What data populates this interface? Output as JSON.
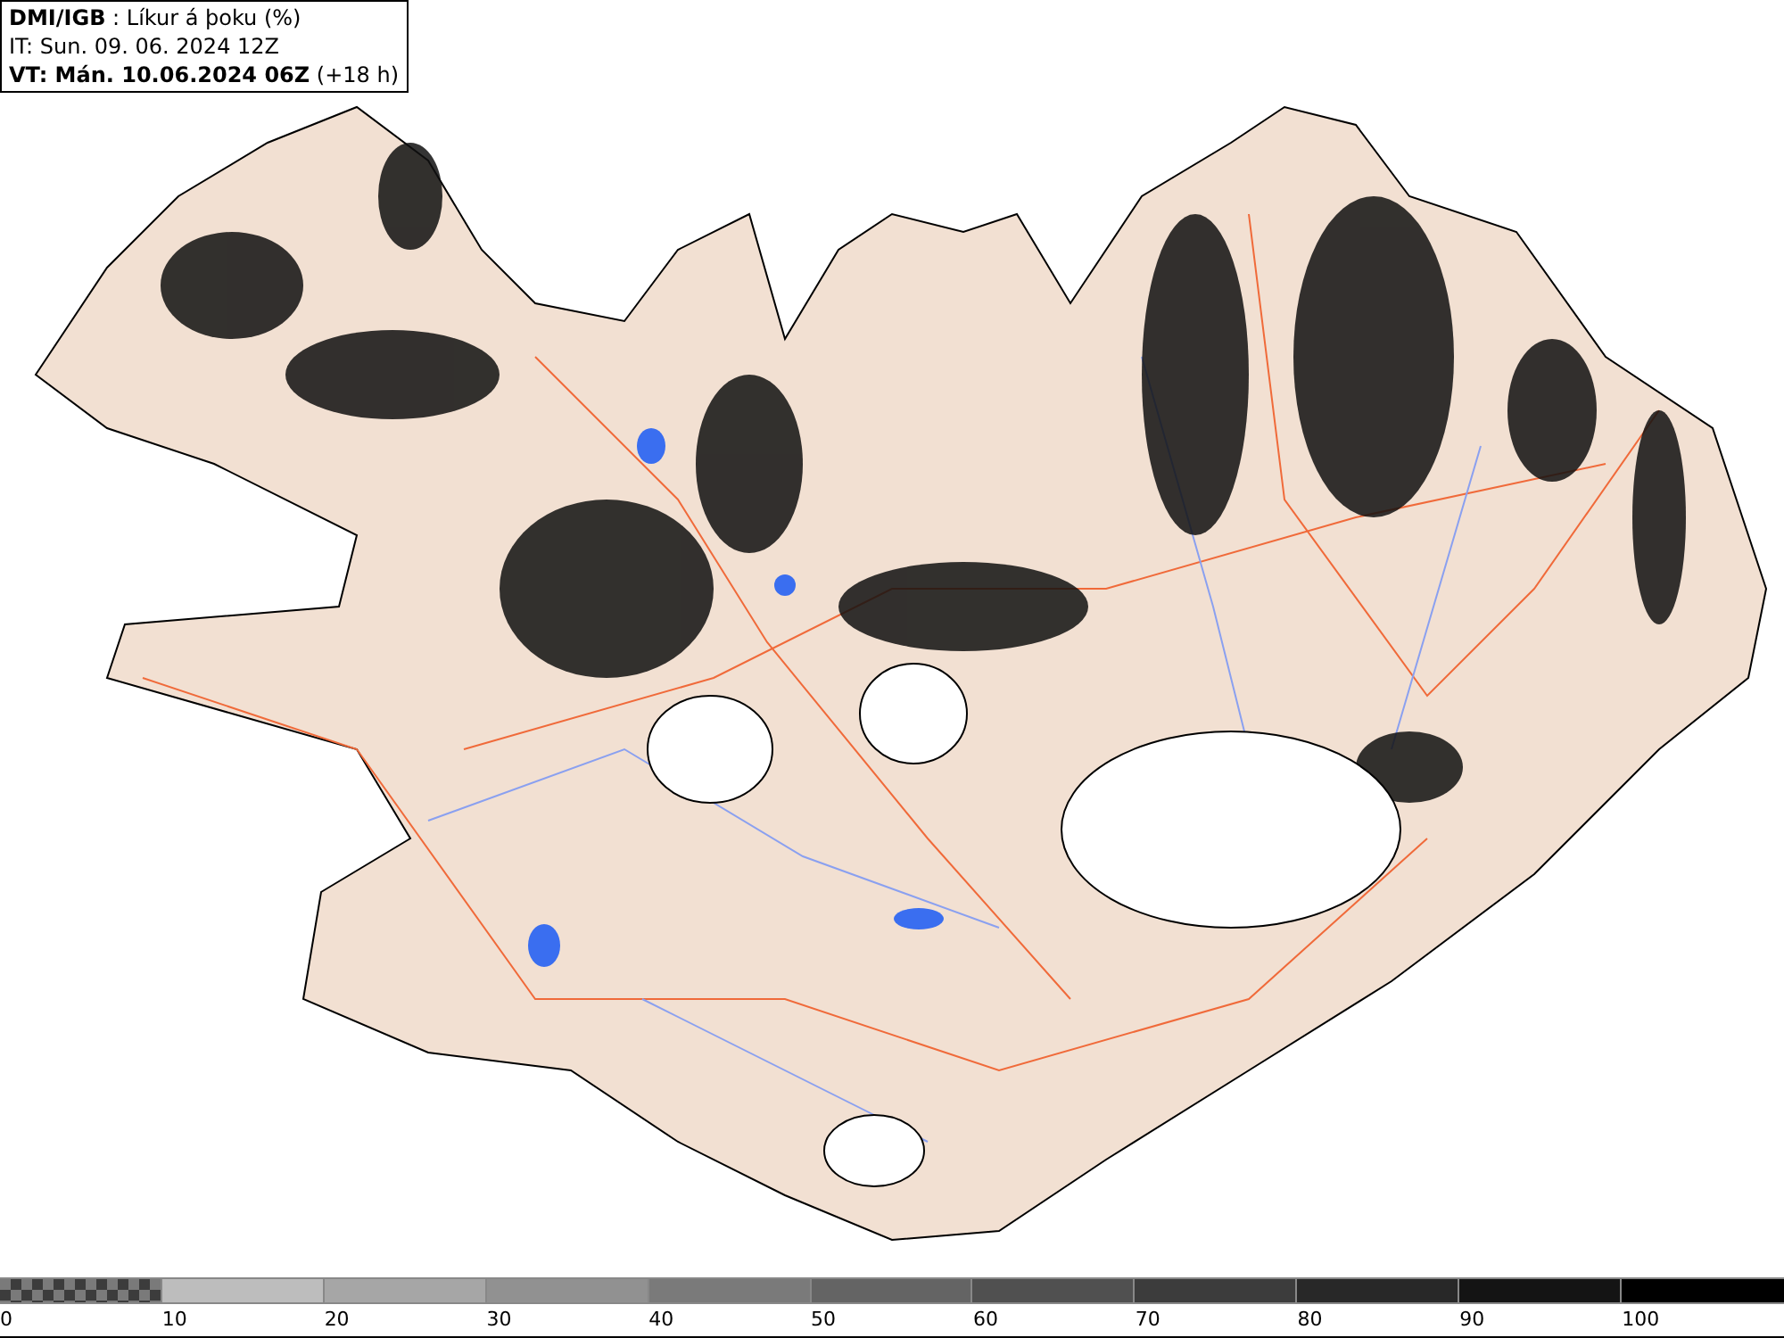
{
  "header": {
    "lines": [
      "**DMI/IGB** : Líkur á þoku (%)",
      "IT: Sun. 09. 06. 2024 12Z",
      "**VT: Mán. 10.06.2024 06Z** (+18 h)"
    ]
  },
  "legend": {
    "bins": [
      {
        "label": "0",
        "kind": "pattern"
      },
      {
        "label": "10",
        "kind": "solid",
        "color": "#bdbdbd"
      },
      {
        "label": "20",
        "kind": "solid",
        "color": "#a6a6a6"
      },
      {
        "label": "30",
        "kind": "solid",
        "color": "#919191"
      },
      {
        "label": "40",
        "kind": "solid",
        "color": "#7a7a7a"
      },
      {
        "label": "50",
        "kind": "solid",
        "color": "#646464"
      },
      {
        "label": "60",
        "kind": "solid",
        "color": "#505050"
      },
      {
        "label": "70",
        "kind": "solid",
        "color": "#3c3c3c"
      },
      {
        "label": "80",
        "kind": "solid",
        "color": "#282828"
      },
      {
        "label": "90",
        "kind": "solid",
        "color": "#141414"
      },
      {
        "label": "100",
        "kind": "solid",
        "color": "#000000"
      }
    ]
  }
}
